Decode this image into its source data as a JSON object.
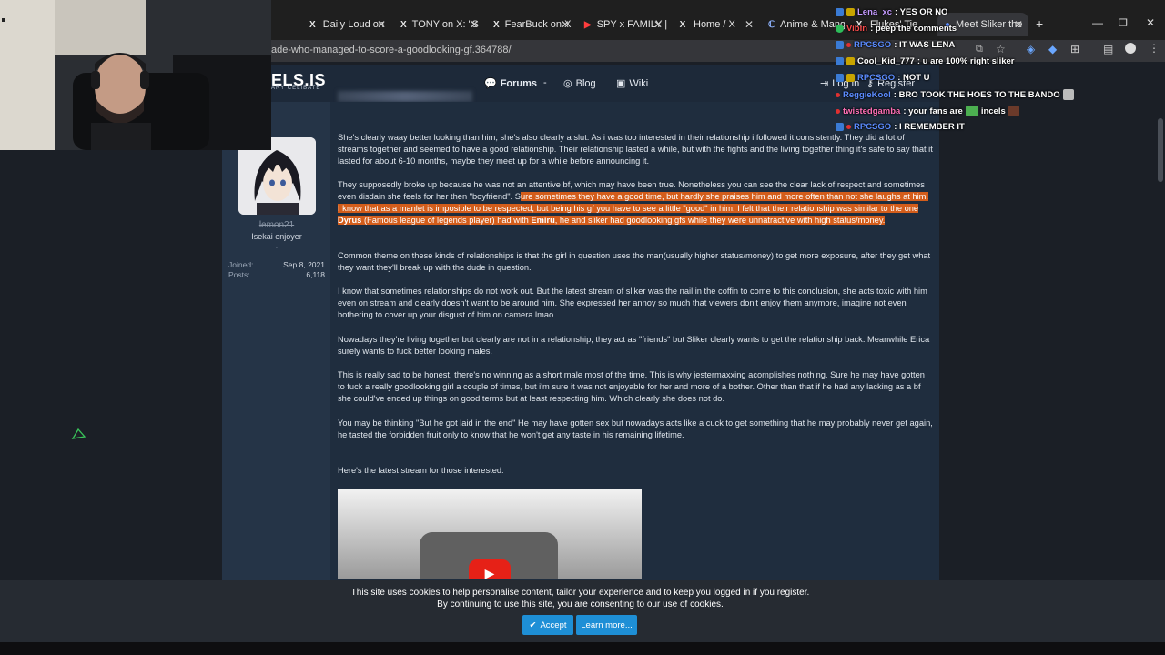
{
  "browser": {
    "tabs": [
      {
        "label": "Daily Loud on",
        "icon": "X"
      },
      {
        "label": "TONY on X: \"S",
        "icon": "X"
      },
      {
        "label": "FearBuck on X",
        "icon": "X"
      },
      {
        "label": "SPY x FAMILY |",
        "icon": "▶"
      },
      {
        "label": "Home / X",
        "icon": "X"
      },
      {
        "label": "Anime & Mang",
        "icon": "ℂ"
      },
      {
        "label": "Flukes' Tie",
        "icon": "X"
      },
      {
        "label": "Meet Sliker the",
        "icon": "●"
      }
    ],
    "new_tab": "+",
    "url": "ade-who-managed-to-score-a-goodlooking-gf.364788/"
  },
  "site": {
    "logo": "ELS.IS",
    "logo_sub": "ARY CELIBATE",
    "nav": {
      "forums": "Forums",
      "dash": "-",
      "blog": "Blog",
      "wiki": "Wiki",
      "login": "Log in",
      "register": "Register"
    }
  },
  "user": {
    "name": "lemon21",
    "title": "Isekai enjoyer",
    "dot": "·",
    "joined_label": "Joined:",
    "joined_value": "Sep 8, 2021",
    "posts_label": "Posts:",
    "posts_value": "6,118"
  },
  "post": {
    "p1": "She's clearly waay better looking than him, she's also clearly a slut. As i was too interested in their relationship i followed it consistently. They did a lot of streams together and seemed to have a good relationship. Their relationship lasted a while, but with the fights and the living together thing it's safe to say that it lasted for about 6-10 months, maybe they meet up for a while before announcing it.",
    "p2_normal": "They supposedly broke up because he was not an attentive bf, which may have been true. Nonetheless you can see the clear lack of respect and sometimes even disdain she feels for her then \"boyfriend\". S",
    "p2_hl1": "ure sometimes they have a good time, but hardly she praises him and more often than not she laughs at him. I know that as a manlet is imposible to be respected, but being his gf you have to see a little \"good\" in him. I felt that their relationship was similar to the one ",
    "p2_b1": "Dyrus",
    "p2_hl2": " (Famous league of legends player) had with ",
    "p2_b2": "Emiru",
    "p2_hl3": ", he and sliker had goodlooking gfs while they were unnatractive with high status/money.",
    "p3": "Common theme on these kinds of relationships is that the girl in question uses the man(usually higher status/money) to get more exposure, after they get what they want they'll break up with the dude in question.",
    "p4": "I know that sometimes relationships do not work out. But the latest stream of sliker was the nail in the coffin to come to this conclusion, she acts toxic with him even on stream and clearly doesn't want to be around him. She expressed her annoy so much that viewers don't enjoy them anymore, imagine not even bothering to cover up your disgust of him on camera lmao.",
    "p5": "Nowadays they're living together but clearly are not in a relationship, they act as \"friends\" but Sliker clearly wants to get the relationship back. Meanwhile Erica surely wants to fuck better looking males.",
    "p6": "This is really sad to be honest, there's no winning as a short male most of the time. This is why jestermaxxing acomplishes nothing. Sure he may have gotten to fuck a really goodlooking girl a couple of times, but i'm sure it was not enjoyable for her and more of a bother. Other than that if he had any lacking as a bf she could've ended up things on good terms but at least respecting him. Which clearly she does not do.",
    "p7": "You may be thinking \"But he got laid in the end\" He may have gotten sex but nowadays acts like a cuck to get something that he may probably never get again, he tasted the forbidden fruit only to know that he won't get any taste in his remaining lifetime.",
    "p8": "Here's the latest stream for those interested:"
  },
  "cookie": {
    "line1": "This site uses cookies to help personalise content, tailor your experience and to keep you logged in if you register.",
    "line2": "By continuing to use this site, you are consenting to our use of cookies.",
    "accept": "Accept",
    "learn": "Learn more..."
  },
  "chat": [
    {
      "user": "Lena_xc",
      "msg": ": YES OR NO",
      "color": "#c59bff"
    },
    {
      "user": "Vibin",
      "msg": ": peep the comments",
      "color": "#ff4d4d"
    },
    {
      "user": "RPCSGO",
      "msg": ": IT WAS LENA",
      "color": "#5b8cff"
    },
    {
      "user": "Cool_Kid_777",
      "msg": ": u are 100% right sliker",
      "color": "#ffffff"
    },
    {
      "user": "RPCSGO",
      "msg": ": NOT U",
      "color": "#5b8cff"
    },
    {
      "user": "ReggieKool",
      "msg": ": BRO TOOK THE HOES TO THE BANDO",
      "color": "#5b8cff"
    },
    {
      "user": "twistedgamba",
      "msg": ": your fans are",
      "color": "#ff6fb5",
      "extra": "incels"
    },
    {
      "user": "RPCSGO",
      "msg": ": I REMEMBER IT",
      "color": "#5b8cff"
    }
  ]
}
